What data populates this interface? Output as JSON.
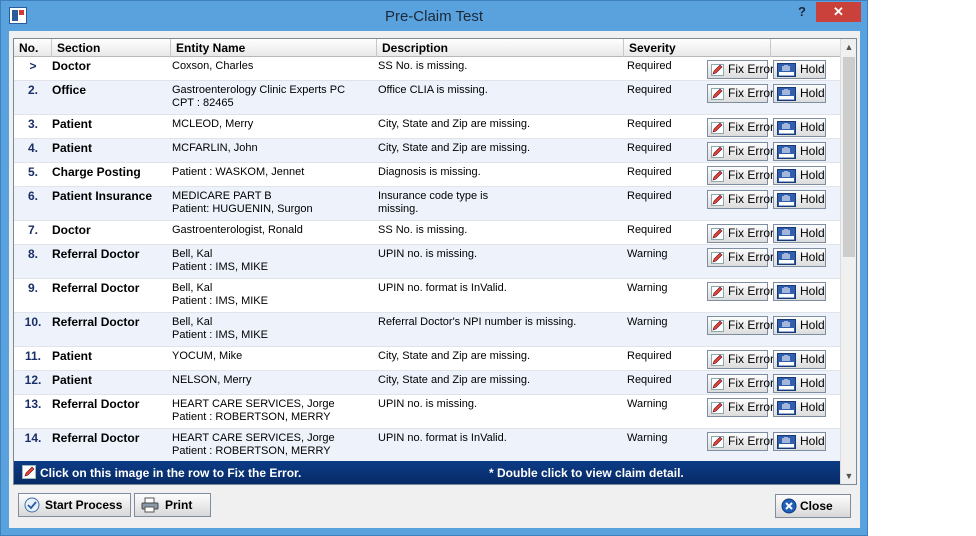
{
  "window": {
    "title": "Pre-Claim Test",
    "help_label": "?",
    "close_label": "✕"
  },
  "columns": {
    "no": "No.",
    "section": "Section",
    "entity": "Entity Name",
    "description": "Description",
    "severity": "Severity"
  },
  "buttons": {
    "fix_label": "Fix Error",
    "hold_label": "Hold",
    "start_label": "Start Process",
    "print_label": "Print",
    "close_label": "Close"
  },
  "rows": [
    {
      "no": ">",
      "section": "Doctor",
      "entity": [
        "Coxson, Charles"
      ],
      "description": [
        "SS No. is missing."
      ],
      "severity": "Required"
    },
    {
      "no": "2.",
      "section": "Office",
      "entity": [
        "Gastroenterology Clinic Experts PC",
        "CPT : 82465"
      ],
      "description": [
        "Office CLIA is missing."
      ],
      "severity": "Required"
    },
    {
      "no": "3.",
      "section": "Patient",
      "entity": [
        "MCLEOD, Merry"
      ],
      "description": [
        "City, State and Zip are missing."
      ],
      "severity": "Required"
    },
    {
      "no": "4.",
      "section": "Patient",
      "entity": [
        "MCFARLIN, John"
      ],
      "description": [
        "City, State and Zip are missing."
      ],
      "severity": "Required"
    },
    {
      "no": "5.",
      "section": "Charge Posting",
      "entity": [
        "Patient : WASKOM, Jennet"
      ],
      "description": [
        "Diagnosis is missing."
      ],
      "severity": "Required"
    },
    {
      "no": "6.",
      "section": "Patient Insurance",
      "entity": [
        "MEDICARE PART B",
        "Patient: HUGUENIN, Surgon"
      ],
      "description": [
        "Insurance code type is",
        "missing."
      ],
      "severity": "Required"
    },
    {
      "no": "7.",
      "section": "Doctor",
      "entity": [
        "Gastroenterologist, Ronald"
      ],
      "description": [
        "SS No. is missing."
      ],
      "severity": "Required"
    },
    {
      "no": "8.",
      "section": "Referral Doctor",
      "entity": [
        "Bell, Kal",
        "Patient : IMS, MIKE"
      ],
      "description": [
        "UPIN no. is missing."
      ],
      "severity": "Warning"
    },
    {
      "no": "9.",
      "section": "Referral Doctor",
      "entity": [
        "Bell, Kal",
        "Patient : IMS, MIKE"
      ],
      "description": [
        "UPIN no. format is InValid."
      ],
      "severity": "Warning"
    },
    {
      "no": "10.",
      "section": "Referral Doctor",
      "entity": [
        "Bell, Kal",
        "Patient : IMS, MIKE"
      ],
      "description": [
        "Referral Doctor's NPI number is missing."
      ],
      "severity": "Warning"
    },
    {
      "no": "11.",
      "section": "Patient",
      "entity": [
        "YOCUM, Mike"
      ],
      "description": [
        "City, State and Zip are missing."
      ],
      "severity": "Required"
    },
    {
      "no": "12.",
      "section": "Patient",
      "entity": [
        "NELSON, Merry"
      ],
      "description": [
        "City, State and Zip are missing."
      ],
      "severity": "Required"
    },
    {
      "no": "13.",
      "section": "Referral Doctor",
      "entity": [
        "HEART CARE SERVICES, Jorge",
        "Patient : ROBERTSON, MERRY"
      ],
      "description": [
        "UPIN no. is missing."
      ],
      "severity": "Warning"
    },
    {
      "no": "14.",
      "section": "Referral Doctor",
      "entity": [
        "HEART CARE SERVICES, Jorge",
        "Patient : ROBERTSON, MERRY"
      ],
      "description": [
        "UPIN no. format is InValid."
      ],
      "severity": "Warning"
    }
  ],
  "info_bar": {
    "left_text": "Click on this image in the row  to Fix the Error.",
    "right_text": "* Double click to view claim detail."
  },
  "icons": {
    "fix": "pencil-icon",
    "hold": "hold-hand-icon",
    "start": "check-circle-icon",
    "print": "printer-icon",
    "close": "close-circle-icon"
  },
  "colors": {
    "titlebar": "#5aa2de",
    "close_red": "#c9413a",
    "info_bar": "#0c3c86",
    "row_alt": "#edf2fb"
  }
}
